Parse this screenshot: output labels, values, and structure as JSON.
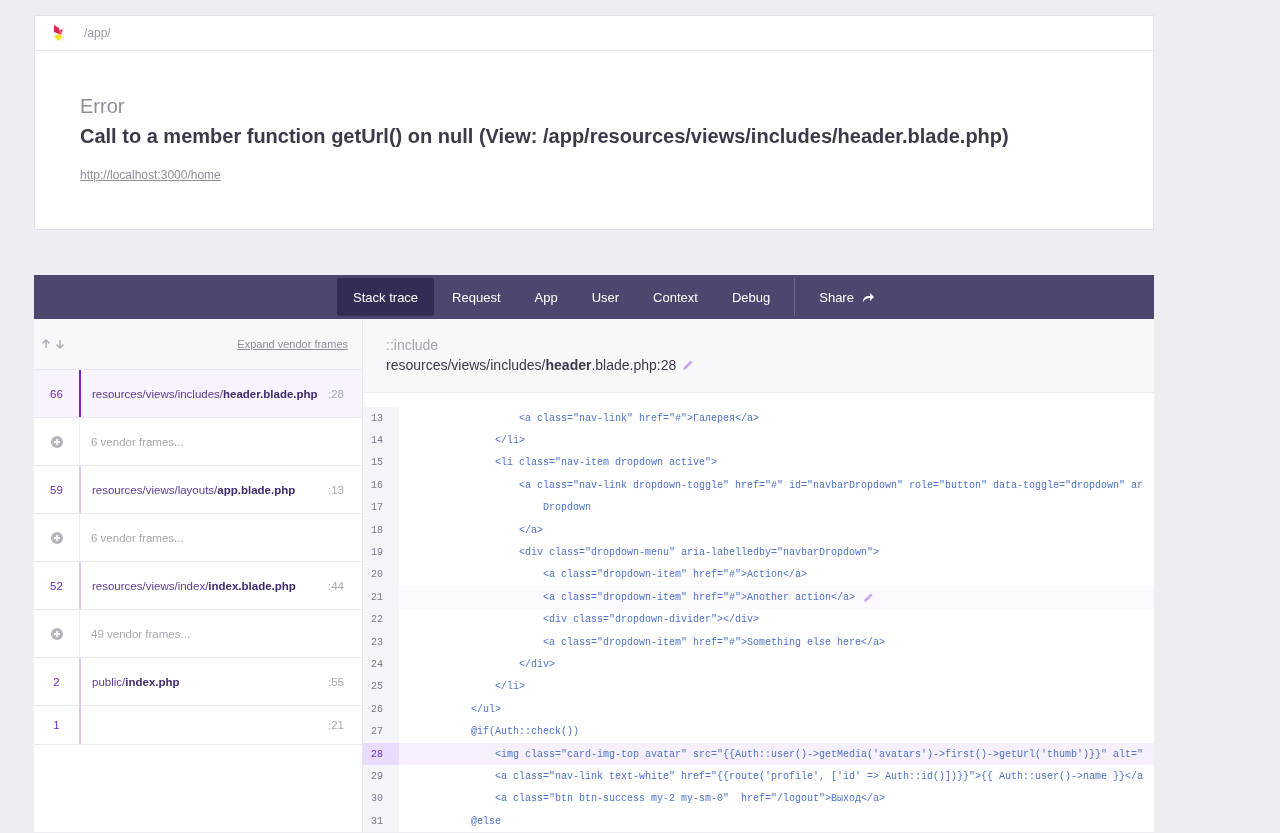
{
  "header": {
    "path": "/app/"
  },
  "error": {
    "type": "Error",
    "message": "Call to a member function getUrl() on null (View: /app/resources/views/includes/header.blade.php)",
    "url": "http://localhost:3000/home"
  },
  "tabs": [
    {
      "label": "Stack trace",
      "selected": true
    },
    {
      "label": "Request",
      "selected": false
    },
    {
      "label": "App",
      "selected": false
    },
    {
      "label": "User",
      "selected": false
    },
    {
      "label": "Context",
      "selected": false
    },
    {
      "label": "Debug",
      "selected": false
    }
  ],
  "share": {
    "label": "Share"
  },
  "frames_toolbar": {
    "expand_label": "Expand vendor frames"
  },
  "frames": [
    {
      "kind": "app",
      "number": "66",
      "file": "resources/views/includes/**header.blade.php**",
      "line": ":28",
      "selected": true
    },
    {
      "kind": "vendor",
      "label": "6 vendor frames..."
    },
    {
      "kind": "app",
      "number": "59",
      "file": "resources/views/layouts/**app.blade.php**",
      "line": ":13",
      "selected": false
    },
    {
      "kind": "vendor",
      "label": "6 vendor frames..."
    },
    {
      "kind": "app",
      "number": "52",
      "file": "resources/views/index/**index.blade.php**",
      "line": ":44",
      "selected": false
    },
    {
      "kind": "vendor",
      "label": "49 vendor frames..."
    },
    {
      "kind": "app",
      "number": "2",
      "file": "public/**index.php**",
      "line": ":55",
      "selected": false
    },
    {
      "kind": "app",
      "number": "1",
      "line": ":21",
      "selected": false
    }
  ],
  "code_header": {
    "method": "::include",
    "file": "resources/views/includes/**header**.blade.php:28"
  },
  "code_lines": [
    {
      "number": "13",
      "code": "                    <a class=\"nav-link\" href=\"#\">Галерея</a>",
      "selected": false,
      "hovered": false
    },
    {
      "number": "14",
      "code": "                </li>",
      "selected": false,
      "hovered": false
    },
    {
      "number": "15",
      "code": "                <li class=\"nav-item dropdown active\">",
      "selected": false,
      "hovered": false
    },
    {
      "number": "16",
      "code": "                    <a class=\"nav-link dropdown-toggle\" href=\"#\" id=\"navbarDropdown\" role=\"button\" data-toggle=\"dropdown\" ar",
      "selected": false,
      "hovered": false
    },
    {
      "number": "17",
      "code": "                        Dropdown",
      "selected": false,
      "hovered": false
    },
    {
      "number": "18",
      "code": "                    </a>",
      "selected": false,
      "hovered": false
    },
    {
      "number": "19",
      "code": "                    <div class=\"dropdown-menu\" aria-labelledby=\"navbarDropdown\">",
      "selected": false,
      "hovered": false
    },
    {
      "number": "20",
      "code": "                        <a class=\"dropdown-item\" href=\"#\">Action</a>",
      "selected": false,
      "hovered": false
    },
    {
      "number": "21",
      "code": "                        <a class=\"dropdown-item\" href=\"#\">Another action</a>",
      "selected": false,
      "hovered": true
    },
    {
      "number": "22",
      "code": "                        <div class=\"dropdown-divider\"></div>",
      "selected": false,
      "hovered": false
    },
    {
      "number": "23",
      "code": "                        <a class=\"dropdown-item\" href=\"#\">Something else here</a>",
      "selected": false,
      "hovered": false
    },
    {
      "number": "24",
      "code": "                    </div>",
      "selected": false,
      "hovered": false
    },
    {
      "number": "25",
      "code": "                </li>",
      "selected": false,
      "hovered": false
    },
    {
      "number": "26",
      "code": "            </ul>",
      "selected": false,
      "hovered": false
    },
    {
      "number": "27",
      "code": "            @if(Auth::check())",
      "selected": false,
      "hovered": false
    },
    {
      "number": "28",
      "code": "                <img class=\"card-img-top avatar\" src=\"{{Auth::user()->getMedia('avatars')->first()->getUrl('thumb')}}\" alt=\"",
      "selected": true,
      "hovered": false
    },
    {
      "number": "29",
      "code": "                <a class=\"nav-link text-white\" href=\"{{route('profile', ['id' => Auth::id()])}}\">{{ Auth::user()->name }}</a",
      "selected": false,
      "hovered": false
    },
    {
      "number": "30",
      "code": "                <a class=\"btn btn-success my-2 my-sm-0\"  href=\"/logout\">Выход</a>",
      "selected": false,
      "hovered": false
    },
    {
      "number": "31",
      "code": "            @else",
      "selected": false,
      "hovered": false
    }
  ]
}
